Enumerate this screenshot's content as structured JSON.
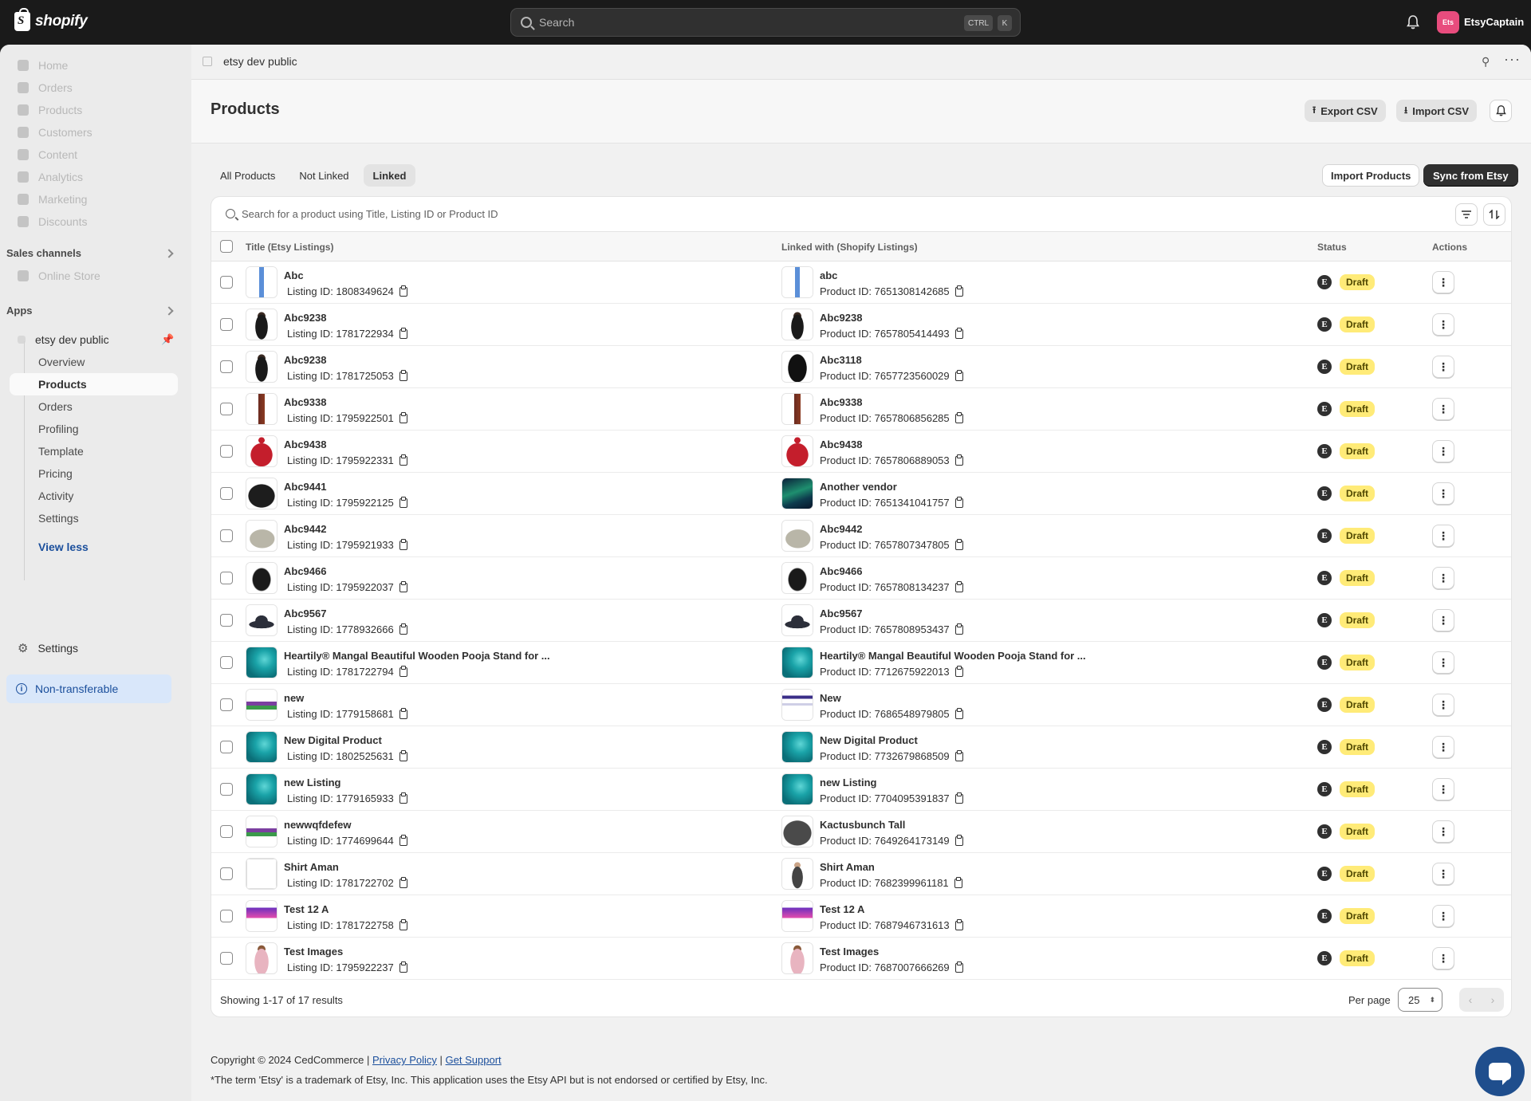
{
  "topbar": {
    "brand": "shopify",
    "search_placeholder": "Search",
    "kbd_ctrl": "CTRL",
    "kbd_k": "K",
    "avatar_initials": "Ets",
    "store_name": "EtsyCaptain"
  },
  "sidebar": {
    "nav": [
      {
        "label": "Home",
        "icon": "home-icon"
      },
      {
        "label": "Orders",
        "icon": "orders-icon"
      },
      {
        "label": "Products",
        "icon": "tag-icon"
      },
      {
        "label": "Customers",
        "icon": "person-icon"
      },
      {
        "label": "Content",
        "icon": "content-icon"
      },
      {
        "label": "Analytics",
        "icon": "chart-icon"
      },
      {
        "label": "Marketing",
        "icon": "target-icon"
      },
      {
        "label": "Discounts",
        "icon": "discount-icon"
      }
    ],
    "sales_channels_label": "Sales channels",
    "online_store": "Online Store",
    "apps_label": "Apps",
    "app_name": "etsy dev public",
    "app_items": [
      "Overview",
      "Products",
      "Orders",
      "Profiling",
      "Template",
      "Pricing",
      "Activity",
      "Settings"
    ],
    "view_less": "View less",
    "settings": "Settings",
    "non_transferable": "Non-transferable"
  },
  "header": {
    "app_name": "etsy dev public",
    "page_title": "Products",
    "export_csv": "Export CSV",
    "import_csv": "Import CSV"
  },
  "tabs": [
    "All Products",
    "Not Linked",
    "Linked"
  ],
  "active_tab": "Linked",
  "actions": {
    "import_products": "Import Products",
    "sync_from_etsy": "Sync from Etsy"
  },
  "table": {
    "search_placeholder": "Search for a product using Title, Listing ID or Product ID",
    "columns": [
      "Title (Etsy Listings)",
      "Linked with (Shopify Listings)",
      "Status",
      "Actions"
    ],
    "listing_prefix": "Listing ID: ",
    "product_prefix": "Product ID: ",
    "rows": [
      {
        "etsy_title": "Abc",
        "listing_id": "1808349624",
        "shop_title": "abc",
        "product_id": "7651308142685",
        "status": "Draft",
        "thumb": "bottle",
        "shop_thumb": "bottle"
      },
      {
        "etsy_title": "Abc9238",
        "listing_id": "1781722934",
        "shop_title": "Abc9238",
        "product_id": "7657805414493",
        "status": "Draft",
        "thumb": "dress",
        "shop_thumb": "dress"
      },
      {
        "etsy_title": "Abc9238",
        "listing_id": "1781725053",
        "shop_title": "Abc3118",
        "product_id": "7657723560029",
        "status": "Draft",
        "thumb": "dress",
        "shop_thumb": "hoodie"
      },
      {
        "etsy_title": "Abc9338",
        "listing_id": "1795922501",
        "shop_title": "Abc9338",
        "product_id": "7657806856285",
        "status": "Draft",
        "thumb": "snowboard",
        "shop_thumb": "snowboard"
      },
      {
        "etsy_title": "Abc9438",
        "listing_id": "1795922331",
        "shop_title": "Abc9438",
        "product_id": "7657806889053",
        "status": "Draft",
        "thumb": "redhat",
        "shop_thumb": "redhat"
      },
      {
        "etsy_title": "Abc9441",
        "listing_id": "1795922125",
        "shop_title": "Another vendor",
        "product_id": "7651341041757",
        "status": "Draft",
        "thumb": "blackhat",
        "shop_thumb": "aurora"
      },
      {
        "etsy_title": "Abc9442",
        "listing_id": "1795921933",
        "shop_title": "Abc9442",
        "product_id": "7657807347805",
        "status": "Draft",
        "thumb": "greyhat",
        "shop_thumb": "greyhat"
      },
      {
        "etsy_title": "Abc9466",
        "listing_id": "1795922037",
        "shop_title": "Abc9466",
        "product_id": "7657808134237",
        "status": "Draft",
        "thumb": "gloves",
        "shop_thumb": "gloves"
      },
      {
        "etsy_title": "Abc9567",
        "listing_id": "1778932666",
        "shop_title": "Abc9567",
        "product_id": "7657808953437",
        "status": "Draft",
        "thumb": "fedora",
        "shop_thumb": "fedora"
      },
      {
        "etsy_title": "Heartily® Mangal Beautiful Wooden Pooja Stand for ...",
        "listing_id": "1781722794",
        "shop_title": "Heartily® Mangal Beautiful Wooden Pooja Stand for ...",
        "product_id": "7712675922013",
        "status": "Draft",
        "thumb": "teal",
        "shop_thumb": "teal"
      },
      {
        "etsy_title": "new",
        "listing_id": "1779158681",
        "shop_title": "New",
        "product_id": "7686548979805",
        "status": "Draft",
        "thumb": "landscape",
        "shop_thumb": "screen"
      },
      {
        "etsy_title": "New Digital Product",
        "listing_id": "1802525631",
        "shop_title": "New Digital Product",
        "product_id": "7732679868509",
        "status": "Draft",
        "thumb": "teal",
        "shop_thumb": "teal"
      },
      {
        "etsy_title": "new Listing",
        "listing_id": "1779165933",
        "shop_title": "new Listing",
        "product_id": "7704095391837",
        "status": "Draft",
        "thumb": "teal",
        "shop_thumb": "teal"
      },
      {
        "etsy_title": "newwqfdefew",
        "listing_id": "1774699644",
        "shop_title": "Kactusbunch Tall",
        "product_id": "7649264173149",
        "status": "Draft",
        "thumb": "landscape",
        "shop_thumb": "darkhat"
      },
      {
        "etsy_title": "Shirt Aman",
        "listing_id": "1781722702",
        "shop_title": "Shirt Aman",
        "product_id": "7682399961181",
        "status": "Draft",
        "thumb": "noimage",
        "shop_thumb": "person"
      },
      {
        "etsy_title": "Test 12 A",
        "listing_id": "1781722758",
        "shop_title": "Test 12 A",
        "product_id": "7687946731613",
        "status": "Draft",
        "thumb": "monitor",
        "shop_thumb": "monitor"
      },
      {
        "etsy_title": "Test Images",
        "listing_id": "1795922237",
        "shop_title": "Test Images",
        "product_id": "7687007666269",
        "status": "Draft",
        "thumb": "pinkperson",
        "shop_thumb": "pinkperson"
      }
    ]
  },
  "footer": {
    "results": "Showing 1-17 of 17 results",
    "per_page_label": "Per page",
    "per_page_value": "25",
    "copyright": "Copyright © 2024 CedCommerce | ",
    "privacy": "Privacy Policy",
    "sep": " | ",
    "support": "Get Support",
    "disclaimer": "*The term 'Etsy' is a trademark of Etsy, Inc. This application uses the Etsy API but is not endorsed or certified by Etsy, Inc."
  },
  "colors": {
    "draft_badge": "#ffeb78",
    "primary_button": "#303030",
    "info_banner": "#d9e7fa",
    "chat": "#1f4e8d"
  }
}
